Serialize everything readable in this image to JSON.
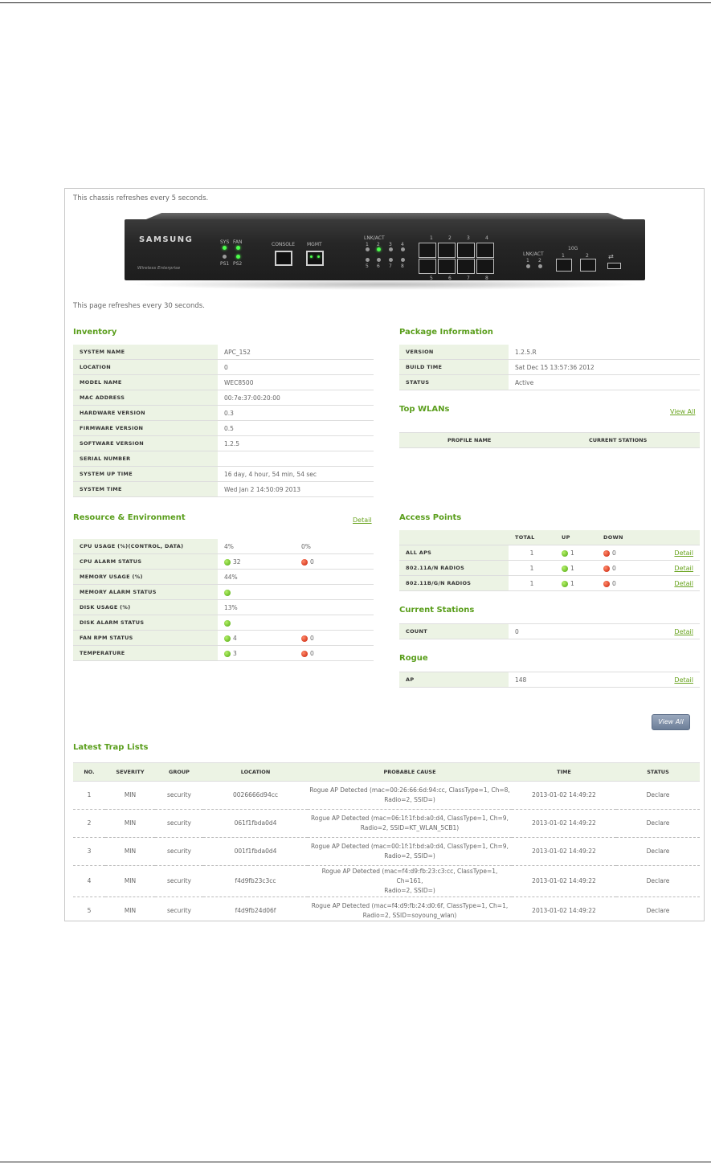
{
  "chassis_note": "This chassis refreshes every 5 seconds.",
  "page_note": "This page refreshes every 30 seconds.",
  "chassis": {
    "brand": "SAMSUNG",
    "subbrand": "Wireless Enterprise",
    "labels": {
      "sys": "SYS",
      "fan": "FAN",
      "ps1": "PS1",
      "ps2": "PS2",
      "console": "CONSOLE",
      "mgmt": "MGMT",
      "lnkact": "LNK/ACT",
      "lnkact2": "LNK/ACT",
      "tenG": "10G",
      "p1": "1",
      "p2": "2",
      "l1": "1",
      "l2": "2",
      "l3": "3",
      "l4": "4",
      "l5": "5",
      "l6": "6",
      "l7": "7",
      "l8": "8",
      "t1": "1",
      "t2": "2",
      "t3": "3",
      "t4": "4",
      "b5": "5",
      "b6": "6",
      "b7": "7",
      "b8": "8",
      "x1": "1",
      "x2": "2"
    }
  },
  "inventory": {
    "title": "Inventory",
    "rows": [
      {
        "k": "SYSTEM NAME",
        "v": "APC_152"
      },
      {
        "k": "LOCATION",
        "v": "0"
      },
      {
        "k": "MODEL NAME",
        "v": "WEC8500"
      },
      {
        "k": "MAC ADDRESS",
        "v": "00:7e:37:00:20:00"
      },
      {
        "k": "HARDWARE VERSION",
        "v": "0.3"
      },
      {
        "k": "FIRMWARE VERSION",
        "v": "0.5"
      },
      {
        "k": "SOFTWARE VERSION",
        "v": "1.2.5"
      },
      {
        "k": "SERIAL NUMBER",
        "v": ""
      },
      {
        "k": "SYSTEM UP TIME",
        "v": "16 day, 4 hour, 54 min, 54 sec"
      },
      {
        "k": "SYSTEM TIME",
        "v": "Wed Jan 2 14:50:09 2013"
      }
    ]
  },
  "package": {
    "title": "Package Information",
    "rows": [
      {
        "k": "VERSION",
        "v": "1.2.5.R"
      },
      {
        "k": "BUILD TIME",
        "v": "Sat Dec 15 13:57:36 2012"
      },
      {
        "k": "STATUS",
        "v": "Active"
      }
    ]
  },
  "top_wlans": {
    "title": "Top WLANs",
    "view_all": "View All",
    "columns": [
      "PROFILE NAME",
      "CURRENT STATIONS"
    ]
  },
  "resource": {
    "title": "Resource & Environment",
    "detail": "Detail",
    "rows": [
      {
        "k": "CPU USAGE (%)(CONTROL, DATA)",
        "v1": "4%",
        "v2": "0%"
      },
      {
        "k": "CPU ALARM STATUS",
        "v1": "32",
        "v2": "0"
      },
      {
        "k": "MEMORY USAGE (%)",
        "v1": "44%",
        "v2": ""
      },
      {
        "k": "MEMORY ALARM STATUS",
        "v1": "",
        "v2": ""
      },
      {
        "k": "DISK USAGE (%)",
        "v1": "13%",
        "v2": ""
      },
      {
        "k": "DISK ALARM STATUS",
        "v1": "",
        "v2": ""
      },
      {
        "k": "FAN RPM STATUS",
        "v1": "4",
        "v2": "0"
      },
      {
        "k": "TEMPERATURE",
        "v1": "3",
        "v2": "0"
      }
    ]
  },
  "access_points": {
    "title": "Access Points",
    "columns": [
      "TOTAL",
      "UP",
      "DOWN"
    ],
    "rows": [
      {
        "k": "ALL APS",
        "total": "1",
        "up": "1",
        "down": "0",
        "detail": "Detail"
      },
      {
        "k": "802.11A/N RADIOS",
        "total": "1",
        "up": "1",
        "down": "0",
        "detail": "Detail"
      },
      {
        "k": "802.11B/G/N RADIOS",
        "total": "1",
        "up": "1",
        "down": "0",
        "detail": "Detail"
      }
    ]
  },
  "current_stations": {
    "title": "Current Stations",
    "k": "COUNT",
    "v": "0",
    "detail": "Detail"
  },
  "rogue": {
    "title": "Rogue",
    "k": "AP",
    "v": "148",
    "detail": "Detail"
  },
  "view_all_button": "View All",
  "trap": {
    "title": "Latest Trap Lists",
    "columns": [
      "NO.",
      "SEVERITY",
      "GROUP",
      "LOCATION",
      "PROBABLE CAUSE",
      "TIME",
      "STATUS"
    ],
    "rows": [
      {
        "no": "1",
        "sev": "MIN",
        "grp": "security",
        "loc": "0026666d94cc",
        "cause1": "Rogue AP Detected (mac=00:26:66:6d:94:cc, ClassType=1, Ch=8,",
        "cause2": "Radio=2, SSID=)",
        "time": "2013-01-02 14:49:22",
        "status": "Declare"
      },
      {
        "no": "2",
        "sev": "MIN",
        "grp": "security",
        "loc": "061f1fbda0d4",
        "cause1": "Rogue AP Detected (mac=06:1f:1f:bd:a0:d4, ClassType=1, Ch=9,",
        "cause2": "Radio=2, SSID=KT_WLAN_5CB1)",
        "time": "2013-01-02 14:49:22",
        "status": "Declare"
      },
      {
        "no": "3",
        "sev": "MIN",
        "grp": "security",
        "loc": "001f1fbda0d4",
        "cause1": "Rogue AP Detected (mac=00:1f:1f:bd:a0:d4, ClassType=1, Ch=9,",
        "cause2": "Radio=2, SSID=)",
        "time": "2013-01-02 14:49:22",
        "status": "Declare"
      },
      {
        "no": "4",
        "sev": "MIN",
        "grp": "security",
        "loc": "f4d9fb23c3cc",
        "cause1": "Rogue AP Detected (mac=f4:d9:fb:23:c3:cc, ClassType=1, Ch=161,",
        "cause2": "Radio=2, SSID=)",
        "time": "2013-01-02 14:49:22",
        "status": "Declare"
      },
      {
        "no": "5",
        "sev": "MIN",
        "grp": "security",
        "loc": "f4d9fb24d06f",
        "cause1": "Rogue AP Detected (mac=f4:d9:fb:24:d0:6f, ClassType=1, Ch=1,",
        "cause2": "Radio=2, SSID=soyoung_wlan)",
        "time": "2013-01-02 14:49:22",
        "status": "Declare"
      }
    ]
  }
}
